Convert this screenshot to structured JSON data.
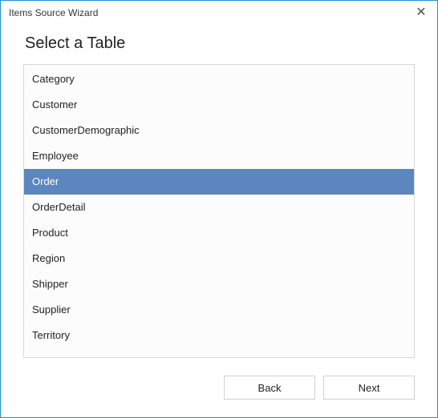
{
  "window": {
    "title": "Items Source Wizard",
    "close_glyph": "✕"
  },
  "heading": "Select a Table",
  "tables": [
    {
      "label": "Category",
      "selected": false
    },
    {
      "label": "Customer",
      "selected": false
    },
    {
      "label": "CustomerDemographic",
      "selected": false
    },
    {
      "label": "Employee",
      "selected": false
    },
    {
      "label": "Order",
      "selected": true
    },
    {
      "label": "OrderDetail",
      "selected": false
    },
    {
      "label": "Product",
      "selected": false
    },
    {
      "label": "Region",
      "selected": false
    },
    {
      "label": "Shipper",
      "selected": false
    },
    {
      "label": "Supplier",
      "selected": false
    },
    {
      "label": "Territory",
      "selected": false
    }
  ],
  "buttons": {
    "back": "Back",
    "next": "Next"
  }
}
